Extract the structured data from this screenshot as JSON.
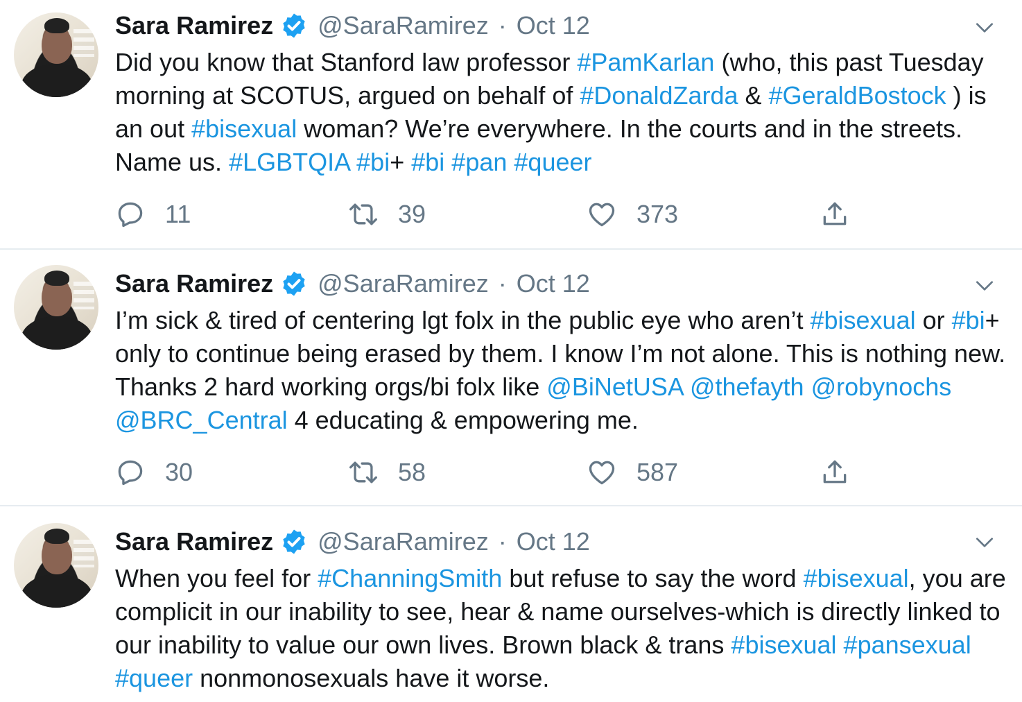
{
  "tweets": [
    {
      "author": {
        "name": "Sara Ramirez",
        "handle": "@SaraRamirez",
        "verified": true
      },
      "date": "Oct 12",
      "segments": [
        {
          "t": "Did you know that Stanford law professor "
        },
        {
          "t": "#PamKarlan",
          "link": true
        },
        {
          "t": " (who, this past Tuesday morning at SCOTUS, argued on behalf of "
        },
        {
          "t": "#DonaldZarda",
          "link": true
        },
        {
          "t": " & "
        },
        {
          "t": "#GeraldBostock",
          "link": true
        },
        {
          "t": " ) is an out "
        },
        {
          "t": "#bisexual",
          "link": true
        },
        {
          "t": " woman? We’re everywhere. In the courts and in the streets. Name us. "
        },
        {
          "t": "#LGBTQIA",
          "link": true
        },
        {
          "t": " "
        },
        {
          "t": "#bi",
          "link": true
        },
        {
          "t": "+ "
        },
        {
          "t": "#bi",
          "link": true
        },
        {
          "t": " "
        },
        {
          "t": "#pan",
          "link": true
        },
        {
          "t": " "
        },
        {
          "t": "#queer",
          "link": true
        }
      ],
      "stats": {
        "replies": "11",
        "retweets": "39",
        "likes": "373"
      }
    },
    {
      "author": {
        "name": "Sara Ramirez",
        "handle": "@SaraRamirez",
        "verified": true
      },
      "date": "Oct 12",
      "segments": [
        {
          "t": "I’m sick & tired of centering lgt folx in the public eye who aren’t "
        },
        {
          "t": "#bisexual",
          "link": true
        },
        {
          "t": " or "
        },
        {
          "t": "#bi",
          "link": true
        },
        {
          "t": "+ only to continue being erased by them. I know I’m not alone. This is nothing new. Thanks 2 hard working orgs/bi folx like "
        },
        {
          "t": "@BiNetUSA",
          "link": true
        },
        {
          "t": " "
        },
        {
          "t": "@thefayth",
          "link": true
        },
        {
          "t": "  "
        },
        {
          "t": "@robynochs",
          "link": true
        },
        {
          "t": " "
        },
        {
          "t": "@BRC_Central",
          "link": true
        },
        {
          "t": " 4 educating & empowering me."
        }
      ],
      "stats": {
        "replies": "30",
        "retweets": "58",
        "likes": "587"
      }
    },
    {
      "author": {
        "name": "Sara Ramirez",
        "handle": "@SaraRamirez",
        "verified": true
      },
      "date": "Oct 12",
      "segments": [
        {
          "t": "When you feel for "
        },
        {
          "t": "#ChanningSmith",
          "link": true
        },
        {
          "t": " but refuse to say the word "
        },
        {
          "t": "#bisexual",
          "link": true
        },
        {
          "t": ", you are complicit in our inability to see, hear & name ourselves-which is directly linked to our inability to value our own lives. Brown black & trans "
        },
        {
          "t": "#bisexual",
          "link": true
        },
        {
          "t": " "
        },
        {
          "t": "#pansexual",
          "link": true
        },
        {
          "t": " "
        },
        {
          "t": "#queer",
          "link": true
        },
        {
          "t": " nonmonosexuals have it worse."
        }
      ],
      "stats": null
    }
  ],
  "separator_dot": "·",
  "colors": {
    "link": "#1b95e0",
    "secondary": "#657786",
    "verified": "#1da1f2",
    "divider": "#e6ecf0"
  },
  "icons": [
    "reply-icon",
    "retweet-icon",
    "like-icon",
    "share-icon",
    "verified-badge-icon",
    "chevron-down-icon"
  ]
}
